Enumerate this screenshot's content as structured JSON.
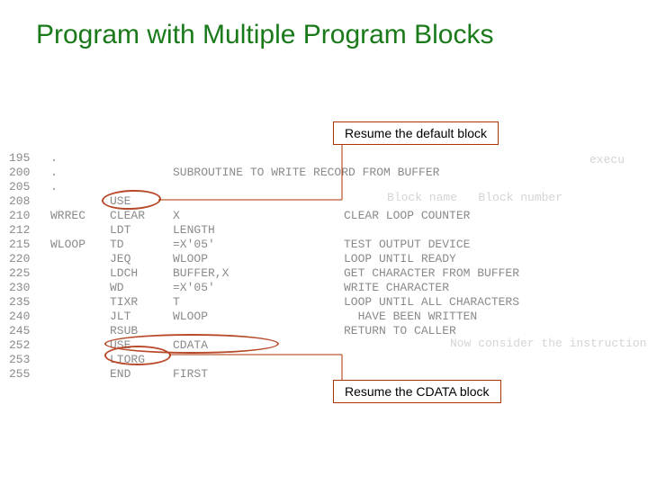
{
  "header": {
    "title": "Program with Multiple Program Blocks"
  },
  "callouts": {
    "top": "Resume the default block",
    "bottom": "Resume the CDATA block"
  },
  "code": [
    {
      "line": "195",
      "label": ".",
      "op": "",
      "arg": "",
      "comment": ""
    },
    {
      "line": "200",
      "label": ".",
      "op": "",
      "arg": "SUBROUTINE TO WRITE RECORD FROM BUFFER",
      "comment": ""
    },
    {
      "line": "205",
      "label": ".",
      "op": "",
      "arg": "",
      "comment": ""
    },
    {
      "line": "208",
      "label": "",
      "op": "USE",
      "arg": "",
      "comment": ""
    },
    {
      "line": "210",
      "label": "WRREC",
      "op": "CLEAR",
      "arg": "X",
      "comment": "CLEAR LOOP COUNTER"
    },
    {
      "line": "212",
      "label": "",
      "op": "LDT",
      "arg": "LENGTH",
      "comment": ""
    },
    {
      "line": "215",
      "label": "WLOOP",
      "op": "TD",
      "arg": "=X'05'",
      "comment": "TEST OUTPUT DEVICE"
    },
    {
      "line": "220",
      "label": "",
      "op": "JEQ",
      "arg": "WLOOP",
      "comment": "LOOP UNTIL READY"
    },
    {
      "line": "225",
      "label": "",
      "op": "LDCH",
      "arg": "BUFFER,X",
      "comment": "GET CHARACTER FROM BUFFER"
    },
    {
      "line": "230",
      "label": "",
      "op": "WD",
      "arg": "=X'05'",
      "comment": "WRITE CHARACTER"
    },
    {
      "line": "235",
      "label": "",
      "op": "TIXR",
      "arg": "T",
      "comment": "LOOP UNTIL ALL CHARACTERS"
    },
    {
      "line": "240",
      "label": "",
      "op": "JLT",
      "arg": "WLOOP",
      "comment": "  HAVE BEEN WRITTEN"
    },
    {
      "line": "245",
      "label": "",
      "op": "RSUB",
      "arg": "",
      "comment": "RETURN TO CALLER"
    },
    {
      "line": "252",
      "label": "",
      "op": "USE",
      "arg": "CDATA",
      "comment": ""
    },
    {
      "line": "253",
      "label": "",
      "op": "LTORG",
      "arg": "",
      "comment": ""
    },
    {
      "line": "255",
      "label": "",
      "op": "END",
      "arg": "FIRST",
      "comment": ""
    }
  ],
  "faded": {
    "right1": "execu",
    "right2": "Block name   Block number",
    "right3": "Now consider the instruction"
  }
}
